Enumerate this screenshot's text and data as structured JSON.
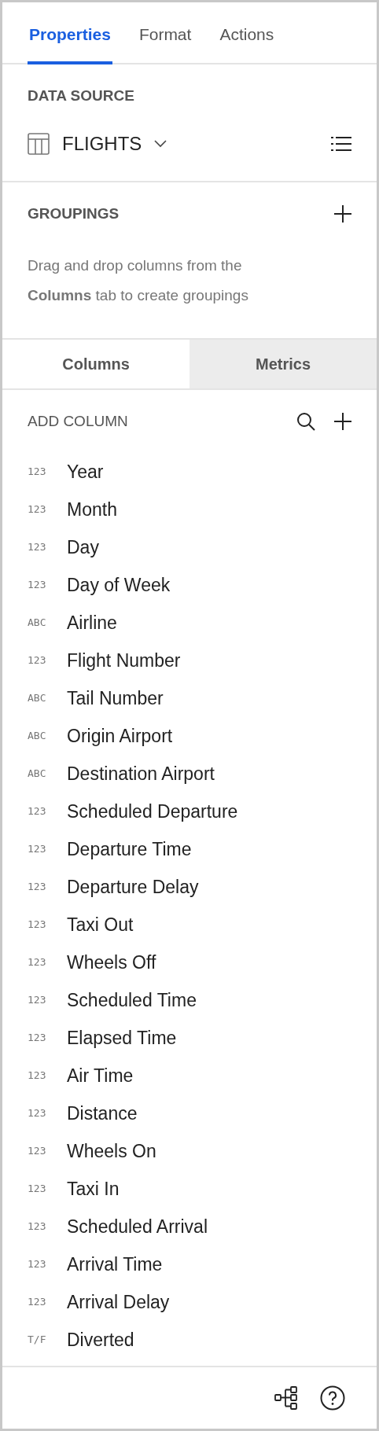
{
  "tabs": [
    {
      "label": "Properties",
      "selected": true
    },
    {
      "label": "Format",
      "selected": false
    },
    {
      "label": "Actions",
      "selected": false
    }
  ],
  "data_source": {
    "heading": "DATA SOURCE",
    "name": "FLIGHTS"
  },
  "groupings": {
    "heading": "GROUPINGS",
    "hint": "Drag and drop columns from the\n**Columns** tab to create groupings"
  },
  "subtabs": [
    {
      "label": "Columns",
      "selected": true
    },
    {
      "label": "Metrics",
      "selected": false
    }
  ],
  "add_column": {
    "label": "ADD COLUMN"
  },
  "columns": [
    {
      "type": "123",
      "name": "Year"
    },
    {
      "type": "123",
      "name": "Month"
    },
    {
      "type": "123",
      "name": "Day"
    },
    {
      "type": "123",
      "name": "Day of Week"
    },
    {
      "type": "ABC",
      "name": "Airline"
    },
    {
      "type": "123",
      "name": "Flight Number"
    },
    {
      "type": "ABC",
      "name": "Tail Number"
    },
    {
      "type": "ABC",
      "name": "Origin Airport"
    },
    {
      "type": "ABC",
      "name": "Destination Airport"
    },
    {
      "type": "123",
      "name": "Scheduled Departure"
    },
    {
      "type": "123",
      "name": "Departure Time"
    },
    {
      "type": "123",
      "name": "Departure Delay"
    },
    {
      "type": "123",
      "name": "Taxi Out"
    },
    {
      "type": "123",
      "name": "Wheels Off"
    },
    {
      "type": "123",
      "name": "Scheduled Time"
    },
    {
      "type": "123",
      "name": "Elapsed Time"
    },
    {
      "type": "123",
      "name": "Air Time"
    },
    {
      "type": "123",
      "name": "Distance"
    },
    {
      "type": "123",
      "name": "Wheels On"
    },
    {
      "type": "123",
      "name": "Taxi In"
    },
    {
      "type": "123",
      "name": "Scheduled Arrival"
    },
    {
      "type": "123",
      "name": "Arrival Time"
    },
    {
      "type": "123",
      "name": "Arrival Delay"
    },
    {
      "type": "T/F",
      "name": "Diverted"
    }
  ]
}
